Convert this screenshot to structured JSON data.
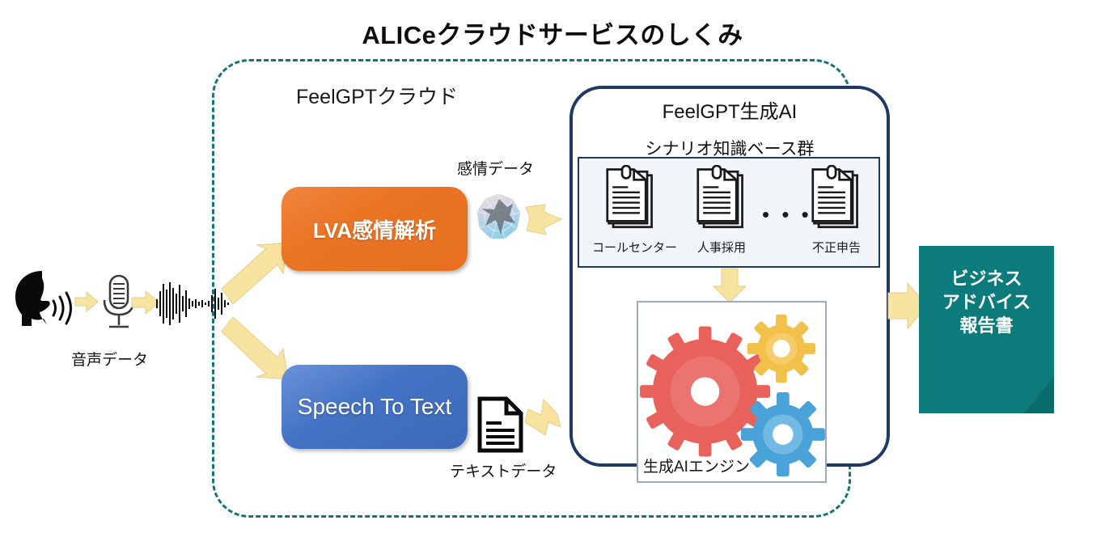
{
  "title": "ALICeクラウドサービスのしくみ",
  "cloud": {
    "label": "FeelGPTクラウド",
    "border_color": "#17737a"
  },
  "pipeline": {
    "input": {
      "speaker_icon": "speaking-head-icon",
      "microphone_icon": "microphone-icon",
      "waveform_icon": "audio-waveform-icon",
      "label": "音声データ"
    },
    "processes": [
      {
        "id": "lva",
        "label": "LVA感情解析",
        "color": "#e8701f",
        "output_label": "感情データ",
        "output_icon": "emotion-radar-chart-icon"
      },
      {
        "id": "stt",
        "label": "Speech To Text",
        "color": "#4472c4",
        "output_label": "テキストデータ",
        "output_icon": "text-document-icon"
      }
    ],
    "arrow_color": "#f8e3a0"
  },
  "genai": {
    "title": "FeelGPT生成AI",
    "border_color": "#1f3864",
    "knowledge_base": {
      "title": "シナリオ知識ベース群",
      "documents": [
        {
          "label": "コールセンター",
          "icon": "document-stack-icon"
        },
        {
          "label": "人事採用",
          "icon": "document-stack-icon"
        },
        {
          "label": "不正申告",
          "icon": "document-stack-icon"
        }
      ],
      "ellipsis": "• • •"
    },
    "engine": {
      "label": "生成AIエンジン",
      "gears": [
        {
          "name": "gear-large",
          "color": "#e8615a"
        },
        {
          "name": "gear-small-top",
          "color": "#f2c14a"
        },
        {
          "name": "gear-small-bottom",
          "color": "#4aa3d8"
        }
      ]
    }
  },
  "output": {
    "lines": [
      "ビジネス",
      "アドバイス",
      "報告書"
    ],
    "color": "#0d7b7b"
  }
}
